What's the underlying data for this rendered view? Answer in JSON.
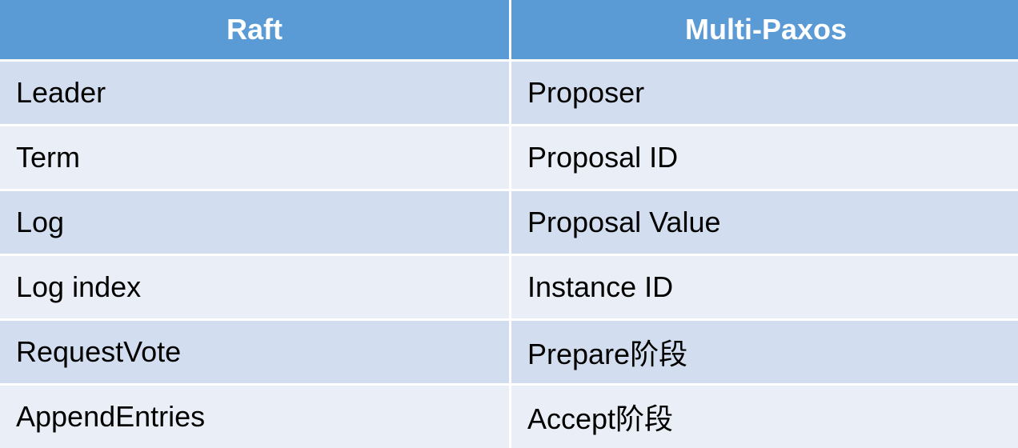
{
  "table": {
    "headers": [
      "Raft",
      "Multi-Paxos"
    ],
    "rows": [
      [
        "Leader",
        "Proposer"
      ],
      [
        "Term",
        "Proposal ID"
      ],
      [
        "Log",
        "Proposal Value"
      ],
      [
        "Log index",
        "Instance ID"
      ],
      [
        "RequestVote",
        "Prepare阶段"
      ],
      [
        "AppendEntries",
        "Accept阶段"
      ]
    ]
  },
  "colors": {
    "header_bg": "#5b9bd5",
    "row_odd_bg": "#d2deef",
    "row_even_bg": "#eaeff7"
  }
}
